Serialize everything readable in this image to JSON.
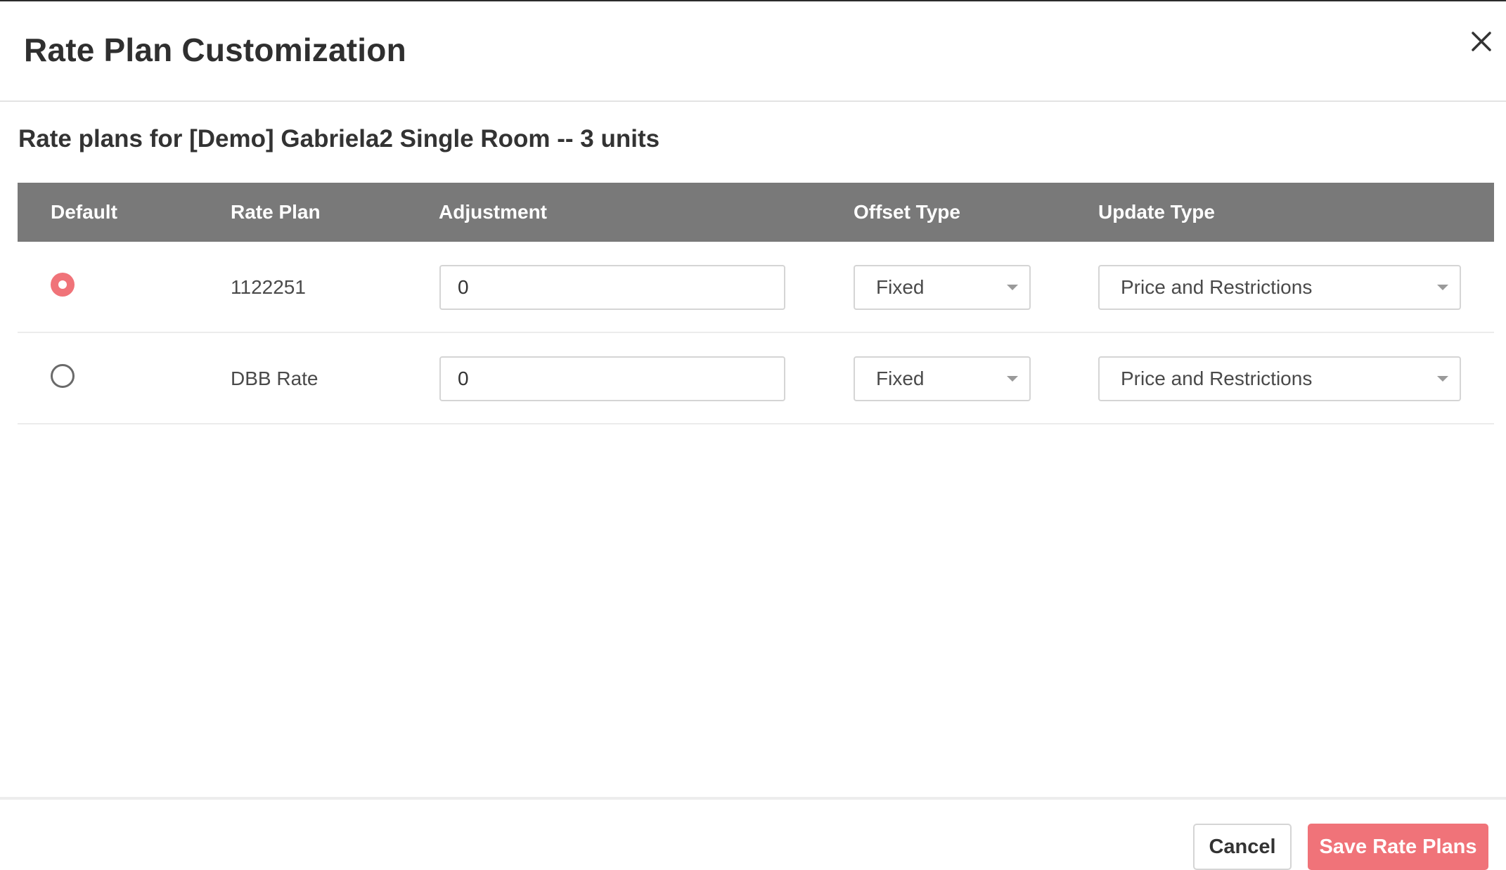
{
  "modal": {
    "title": "Rate Plan Customization",
    "close_icon": "close-icon"
  },
  "subtitle": "Rate plans for [Demo] Gabriela2 Single Room -- 3 units",
  "table": {
    "headers": {
      "default": "Default",
      "rate_plan": "Rate Plan",
      "adjustment": "Adjustment",
      "offset_type": "Offset Type",
      "update_type": "Update Type"
    },
    "rows": [
      {
        "default": true,
        "rate_plan": "1122251",
        "adjustment": "0",
        "offset_type": "Fixed",
        "update_type": "Price and Restrictions"
      },
      {
        "default": false,
        "rate_plan": "DBB Rate",
        "adjustment": "0",
        "offset_type": "Fixed",
        "update_type": "Price and Restrictions"
      }
    ]
  },
  "footer": {
    "cancel_label": "Cancel",
    "save_label": "Save Rate Plans"
  },
  "colors": {
    "accent": "#f07379",
    "table_header_bg": "#797979",
    "text": "#333333"
  }
}
